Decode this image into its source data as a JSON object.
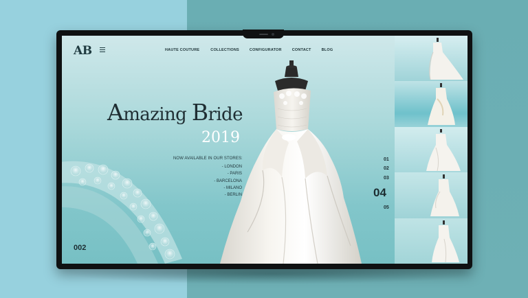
{
  "brand": {
    "logo": "AB"
  },
  "nav": {
    "items": [
      {
        "label": "HAUTE COUTURE"
      },
      {
        "label": "COLLECTIONS"
      },
      {
        "label": "CONFIGURATOR"
      },
      {
        "label": "CONTACT"
      },
      {
        "label": "BLOG"
      }
    ]
  },
  "hero": {
    "title_cap_1": "A",
    "title_rest_1": "mazing ",
    "title_cap_2": "B",
    "title_rest_2": "ride",
    "year": "2019"
  },
  "stores": {
    "label": "NOW AVAILABLE IN OUR STORES:",
    "items": [
      "- LONDON",
      "- PARIS",
      "- BARCELONA",
      "- MILANO",
      "- BERLIN"
    ]
  },
  "counter": "002",
  "pager": {
    "items": [
      "01",
      "02",
      "03",
      "04",
      "05"
    ],
    "active": "04"
  },
  "colors": {
    "page_left": "#97d1de",
    "page_right": "#6aaeb3",
    "screen_top": "#cfe8ea",
    "screen_bottom": "#77c0c4",
    "text_dark": "#1f2e33",
    "year_white": "#ffffff"
  },
  "icons": {
    "menu": "hamburger-icon"
  }
}
